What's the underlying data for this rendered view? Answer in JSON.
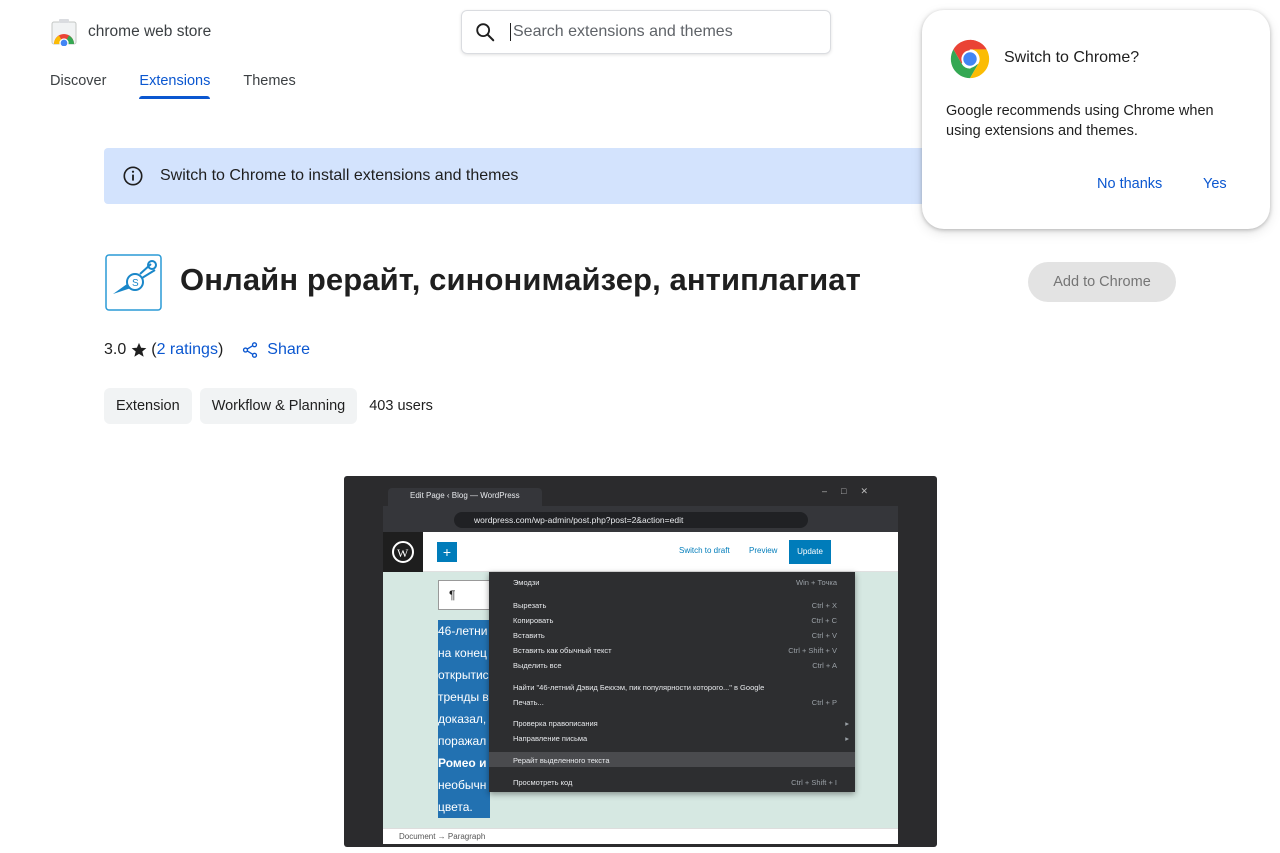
{
  "header": {
    "logo_text": "chrome web store",
    "search_placeholder": "Search extensions and themes",
    "nav": [
      {
        "label": "Discover",
        "active": false
      },
      {
        "label": "Extensions",
        "active": true
      },
      {
        "label": "Themes",
        "active": false
      }
    ]
  },
  "banner": {
    "text": "Switch to Chrome to install extensions and themes"
  },
  "extension": {
    "title": "Онлайн рерайт, синонимайзер, антиплагиат",
    "add_button": "Add to Chrome",
    "rating_value": "3.0",
    "rating_open": "(",
    "rating_link": "2 ratings",
    "rating_close": ")",
    "share_label": "Share",
    "chips": [
      "Extension",
      "Workflow & Planning"
    ],
    "users": "403 users"
  },
  "popup": {
    "title": "Switch to Chrome?",
    "body": "Google recommends using Chrome when using extensions and themes.",
    "no_button": "No thanks",
    "yes_button": "Yes"
  },
  "screenshot": {
    "tab_title": "Edit Page ‹ Blog — WordPress",
    "url": "wordpress.com/wp-admin/post.php?post=2&action=edit",
    "wp_switch": "Switch to draft",
    "wp_preview": "Preview",
    "wp_update": "Update",
    "menu": [
      {
        "label": "Эмодзи",
        "shortcut": "Win + Точка"
      },
      {
        "label": "Вырезать",
        "shortcut": "Ctrl + X"
      },
      {
        "label": "Копировать",
        "shortcut": "Ctrl + C"
      },
      {
        "label": "Вставить",
        "shortcut": "Ctrl + V"
      },
      {
        "label": "Вставить как обычный текст",
        "shortcut": "Ctrl + Shift + V"
      },
      {
        "label": "Выделить все",
        "shortcut": "Ctrl + A"
      },
      {
        "label": "Найти \"46-летний Дэвид Бекхэм, пик популярности которого...\" в Google",
        "shortcut": ""
      },
      {
        "label": "Печать...",
        "shortcut": "Ctrl + P"
      },
      {
        "label": "Проверка правописания",
        "shortcut": "▸"
      },
      {
        "label": "Направление письма",
        "shortcut": "▸"
      },
      {
        "label": "Рерайт выделенного текста",
        "shortcut": ""
      },
      {
        "label": "Просмотреть код",
        "shortcut": "Ctrl + Shift + I"
      }
    ],
    "text_lines": [
      "46-летни",
      "на конец",
      "открытис",
      "тренды в",
      "доказал,",
      "поражал",
      "Ромео и",
      "необычн",
      "цвета."
    ],
    "footer": "Document → Paragraph"
  },
  "colors": {
    "accent": "#0b57d0",
    "banner_bg": "#d3e3fd",
    "wp_blue": "#007cba"
  }
}
